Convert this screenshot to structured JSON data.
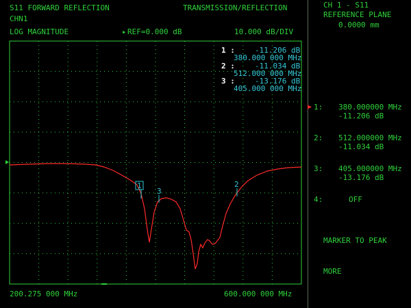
{
  "header": {
    "title_left": "S11 FORWARD REFLECTION",
    "title_right": "TRANSMISSION/REFLECTION",
    "channel": "CHN1",
    "format": "LOG MAGNITUDE",
    "ref_arrow": "▸",
    "ref": "REF=0.000 dB",
    "scale": "10.000 dB/DIV"
  },
  "plot_markers": [
    {
      "num": "1 :",
      "value": "-11.206 dB",
      "freq": "380.000 000 MHz"
    },
    {
      "num": "2 :",
      "value": "-11.034 dB",
      "freq": "512.000 000 MHz"
    },
    {
      "num": "3 :",
      "value": "-13.176 dB",
      "freq": "405.000 000 MHz"
    }
  ],
  "trace_labels": {
    "m1": "1",
    "m2": "2",
    "m3": "3"
  },
  "footer": {
    "start": "200.275 000 MHz",
    "stop": "600.000 000 MHz"
  },
  "side": {
    "title": "CH 1 - S11",
    "subtitle": "REFERENCE PLANE",
    "plane": "0.0000 mm",
    "markers": [
      {
        "label": "1:",
        "freq": "380.000000 MHz",
        "value": "-11.206 dB",
        "active": true
      },
      {
        "label": "2:",
        "freq": "512.000000 MHz",
        "value": "-11.034 dB",
        "active": false
      },
      {
        "label": "3:",
        "freq": "405.000000 MHz",
        "value": "-13.176 dB",
        "active": false
      },
      {
        "label": "4:",
        "freq": "OFF",
        "value": "",
        "active": false
      }
    ],
    "marker_to_peak": "MARKER TO PEAK",
    "more": "MORE",
    "active_arrow": "▶"
  },
  "colors": {
    "grid": "#2fd13a",
    "trace": "#ff2a2a",
    "text_cyan": "#35c8d8"
  }
}
